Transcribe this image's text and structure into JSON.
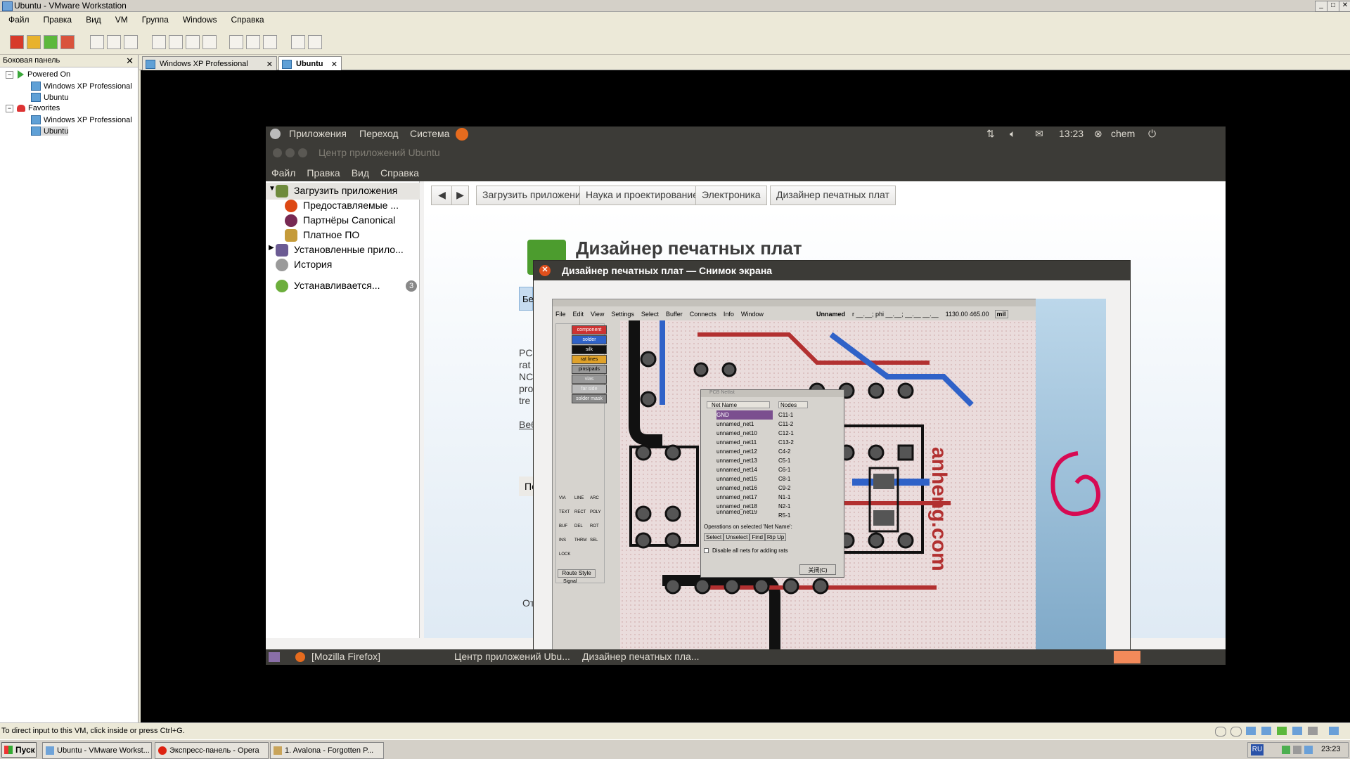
{
  "vmware": {
    "title": "Ubuntu - VMware Workstation",
    "menu": [
      "Файл",
      "Правка",
      "Вид",
      "VM",
      "Группа",
      "Windows",
      "Справка"
    ],
    "library": {
      "header": "Боковая панель",
      "close": "✕",
      "groups": [
        {
          "label": "Powered On",
          "items": [
            "Windows XP Professional",
            "Ubuntu"
          ]
        },
        {
          "label": "Favorites",
          "items": [
            "Windows XP Professional",
            "Ubuntu"
          ]
        }
      ]
    },
    "tabs": [
      {
        "label": "Windows XP Professional",
        "active": false
      },
      {
        "label": "Ubuntu",
        "active": true
      }
    ],
    "status_text": "To direct input to this VM, click inside or press Ctrl+G."
  },
  "ubuntu": {
    "top_panel": {
      "menus": [
        "Приложения",
        "Переход",
        "Система"
      ],
      "time": "13:23",
      "user": "chem"
    },
    "software_center": {
      "title": "Центр приложений Ubuntu",
      "menu": [
        "Файл",
        "Правка",
        "Вид",
        "Справка"
      ],
      "sidebar": [
        {
          "label": "Загрузить приложения",
          "selected": true
        },
        {
          "label": "Предоставляемые ..."
        },
        {
          "label": "Партнёры Canonical"
        },
        {
          "label": "Платное ПО"
        },
        {
          "label": "Установленные прило..."
        },
        {
          "label": "История"
        },
        {
          "label": "Устанавливается...",
          "count": "3"
        }
      ],
      "breadcrumbs": [
        "Загрузить приложения",
        "Наука и проектирование",
        "Электроника",
        "Дизайнер печатных плат"
      ],
      "app_title": "Дизайнер печатных плат",
      "partial_texts": [
        "Бе",
        "PCI",
        "rat",
        "NC",
        "pro",
        "tre",
        "Веб",
        "По",
        "От"
      ]
    },
    "screenshot_window": {
      "title": "Дизайнер печатных плат — Снимок экрана",
      "pcb": {
        "menu": [
          "File",
          "Edit",
          "View",
          "Settings",
          "Select",
          "Buffer",
          "Connects",
          "Info",
          "Window"
        ],
        "doc_name": "Unnamed",
        "coords_label": "r __.__; phi __.__; __.__ __.__",
        "coords": "1130.00 465.00",
        "unit": "mil",
        "layers": [
          "component",
          "solder",
          "silk",
          "rat lines",
          "pins/pads",
          "vias",
          "far side",
          "solder mask"
        ],
        "tools": [
          "VIA",
          "LINE",
          "ARC",
          "TEXT",
          "RECT",
          "POLY",
          "BUF",
          "DEL",
          "ROT",
          "INS",
          "THRM",
          "SEL",
          "LOCK"
        ],
        "route_style": "Route Style",
        "signal": "Signal",
        "netlist": {
          "title": "PCB Netlist",
          "col_net": "Net Name",
          "col_nodes": "Nodes",
          "nets": [
            "GND",
            "unnamed_net1",
            "unnamed_net10",
            "unnamed_net11",
            "unnamed_net12",
            "unnamed_net13",
            "unnamed_net14",
            "unnamed_net15",
            "unnamed_net16",
            "unnamed_net17",
            "unnamed_net18",
            "unnamed_net19"
          ],
          "nodes": [
            "C11-1",
            "C11-2",
            "C12-1",
            "C13-2",
            "C4-2",
            "C5-1",
            "C6-1",
            "C8-1",
            "C9-2",
            "N1-1",
            "N2-1",
            "R5-1"
          ],
          "ops_label": "Operations on selected 'Net Name':",
          "buttons": [
            "Select",
            "Unselect",
            "Find",
            "Rip Up"
          ],
          "checkbox": "Disable all nets for adding rats",
          "close": "关闭(C)"
        },
        "board_text": "anheng.com"
      }
    },
    "bottom_panel": [
      "[Mozilla Firefox]",
      "Центр приложений Ubu...",
      "Дизайнер печатных пла..."
    ]
  },
  "taskbar": {
    "start": "Пуск",
    "tasks": [
      "Ubuntu - VMware Workst...",
      "Экспресс-панель - Opera",
      "1. Avalona - Forgotten P..."
    ],
    "lang": "RU",
    "time": "23:23"
  }
}
